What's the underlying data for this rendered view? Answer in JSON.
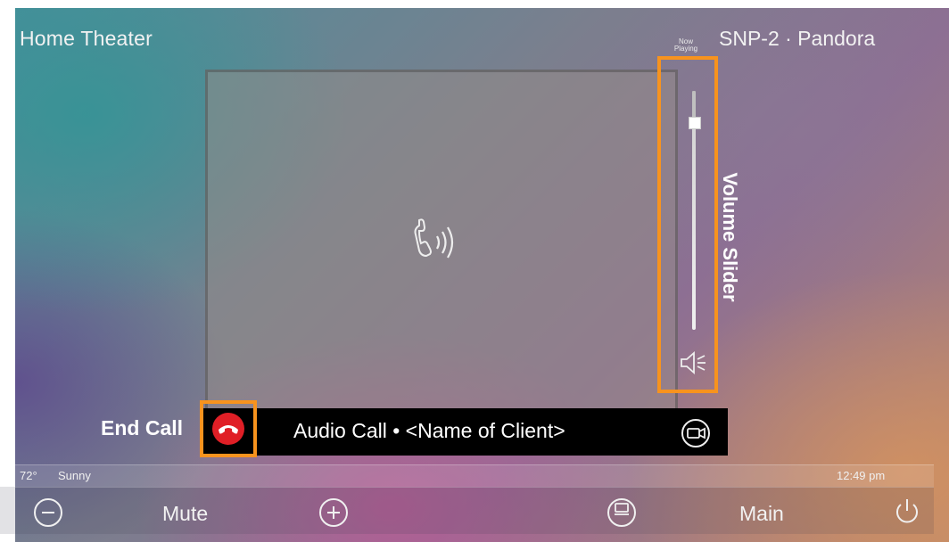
{
  "header": {
    "title": "Home Theater",
    "now_playing_label": [
      "Now",
      "Playing"
    ],
    "source": "SNP-2 · Pandora"
  },
  "call": {
    "type_icon": "phone-ringing-icon",
    "bar_text": "Audio Call • <Name of Client>",
    "end_call_icon": "hang-up-icon",
    "camera_icon": "video-camera-icon"
  },
  "volume": {
    "level": 0.87,
    "mute_icon": "speaker-mute-icon"
  },
  "callouts": {
    "volume": "Volume Slider",
    "end_call": "End Call",
    "color": "#f7931e"
  },
  "status": {
    "temperature": "72°",
    "condition": "Sunny",
    "time": "12:49 pm"
  },
  "controls": {
    "minus_icon": "minus-circle-icon",
    "mute_label": "Mute",
    "plus_icon": "plus-circle-icon",
    "menu_icon": "remote-menu-icon",
    "main_label": "Main",
    "power_icon": "power-icon"
  },
  "colors": {
    "end_call_red": "#e01f26",
    "call_bar": "#000000",
    "text": "#f2f2f2"
  }
}
